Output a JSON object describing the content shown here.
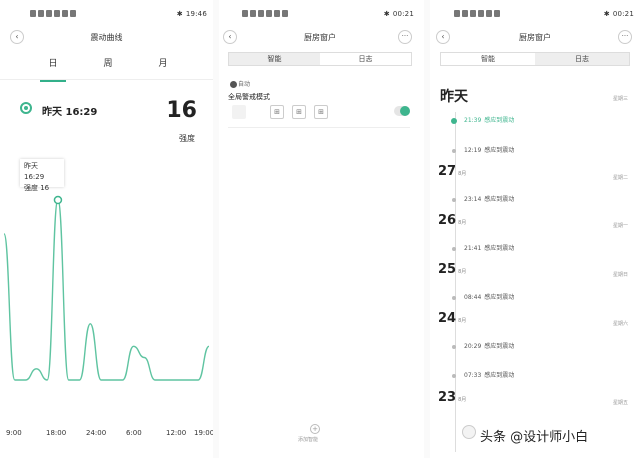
{
  "colors": {
    "accent": "#3eb58e",
    "line": "#5fc4a1"
  },
  "screen1": {
    "status": {
      "time": "19:46",
      "battery": ""
    },
    "title": "震动曲线",
    "tabs": [
      "日",
      "周",
      "月"
    ],
    "event_time": "昨天 16:29",
    "value": "16",
    "value_label": "强度",
    "tooltip": {
      "line1": "昨天 16:29",
      "line2": "强度 16"
    },
    "chart_data": {
      "type": "line",
      "x_ticks": [
        "9:00",
        "18:00",
        "24:00",
        "6:00",
        "12:00",
        "19:00"
      ],
      "series": [
        {
          "values": [
            13,
            0,
            0,
            1,
            0,
            16,
            0,
            0,
            5,
            0,
            0,
            0,
            3,
            2,
            0,
            0,
            0,
            0,
            0,
            3
          ]
        }
      ]
    }
  },
  "screen2": {
    "status": {
      "time": "00:21"
    },
    "title": "厨房窗户",
    "tabs": [
      "智能",
      "日志"
    ],
    "auto_label": "自动",
    "mode_title": "全局警戒模式",
    "add_label": "添加智能"
  },
  "screen3": {
    "status": {
      "time": "00:21"
    },
    "title": "厨房窗户",
    "tabs": [
      "智能",
      "日志"
    ],
    "yesterday": {
      "label": "昨天",
      "week": "星期三",
      "entries": [
        {
          "time": "21:39",
          "text": "感应到震动"
        },
        {
          "time": "12:19",
          "text": "感应到震动"
        }
      ]
    },
    "days": [
      {
        "day": "27",
        "month": "8月",
        "week": "星期二",
        "entries": [
          {
            "time": "23:14",
            "text": "感应到震动"
          }
        ]
      },
      {
        "day": "26",
        "month": "8月",
        "week": "星期一",
        "entries": [
          {
            "time": "21:41",
            "text": "感应到震动"
          }
        ]
      },
      {
        "day": "25",
        "month": "8月",
        "week": "星期日",
        "entries": [
          {
            "time": "08:44",
            "text": "感应到震动"
          }
        ]
      },
      {
        "day": "24",
        "month": "8月",
        "week": "星期六",
        "entries": [
          {
            "time": "20:29",
            "text": "感应到震动"
          },
          {
            "time": "07:33",
            "text": "感应到震动"
          }
        ]
      },
      {
        "day": "23",
        "month": "8月",
        "week": "星期五",
        "entries": []
      }
    ]
  },
  "watermark": "头条 @设计师小白"
}
